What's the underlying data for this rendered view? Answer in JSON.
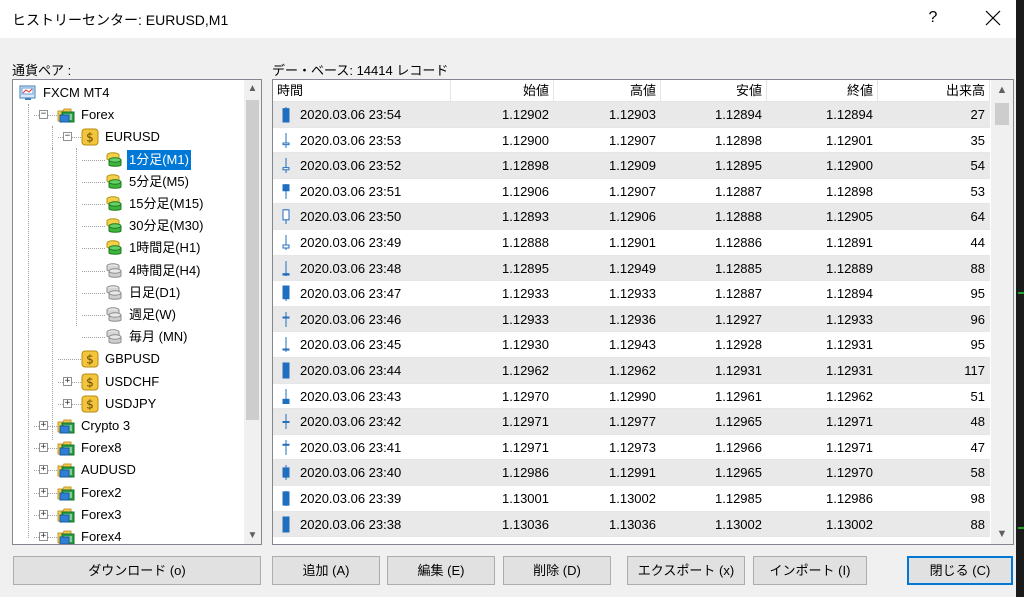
{
  "window": {
    "title": "ヒストリーセンター: EURUSD,M1",
    "help": "?"
  },
  "labels": {
    "pairs": "通貨ペア :",
    "database": "デー・ベース: 14414 レコード"
  },
  "tree": [
    {
      "label": "FXCM MT4",
      "level": 0,
      "icon": "server-icon"
    },
    {
      "label": "Forex",
      "level": 1,
      "icon": "folder-icon",
      "expander": "−"
    },
    {
      "label": "EURUSD",
      "level": 2,
      "icon": "symbol-icon",
      "expander": "−"
    },
    {
      "label": "1分足(M1)",
      "level": 3,
      "icon": "db-green-icon",
      "selected": true
    },
    {
      "label": "5分足(M5)",
      "level": 3,
      "icon": "db-green-icon"
    },
    {
      "label": "15分足(M15)",
      "level": 3,
      "icon": "db-green-icon"
    },
    {
      "label": "30分足(M30)",
      "level": 3,
      "icon": "db-green-icon"
    },
    {
      "label": "1時間足(H1)",
      "level": 3,
      "icon": "db-green-icon"
    },
    {
      "label": "4時間足(H4)",
      "level": 3,
      "icon": "db-gray-icon"
    },
    {
      "label": "日足(D1)",
      "level": 3,
      "icon": "db-gray-icon"
    },
    {
      "label": "週足(W)",
      "level": 3,
      "icon": "db-gray-icon"
    },
    {
      "label": "毎月 (MN)",
      "level": 3,
      "icon": "db-gray-icon"
    },
    {
      "label": "GBPUSD",
      "level": 2,
      "icon": "symbol-icon"
    },
    {
      "label": "USDCHF",
      "level": 2,
      "icon": "symbol-icon",
      "expander": "+"
    },
    {
      "label": "USDJPY",
      "level": 2,
      "icon": "symbol-icon",
      "expander": "+"
    },
    {
      "label": "Crypto 3",
      "level": 1,
      "icon": "folder-icon",
      "expander": "+"
    },
    {
      "label": "Forex8",
      "level": 1,
      "icon": "folder-icon",
      "expander": "+"
    },
    {
      "label": "AUDUSD",
      "level": 1,
      "icon": "folder-icon",
      "expander": "+"
    },
    {
      "label": "Forex2",
      "level": 1,
      "icon": "folder-icon",
      "expander": "+"
    },
    {
      "label": "Forex3",
      "level": 1,
      "icon": "folder-icon",
      "expander": "+"
    },
    {
      "label": "Forex4",
      "level": 1,
      "icon": "folder-icon",
      "expander": "+"
    }
  ],
  "table": {
    "columns": [
      "時間",
      "始値",
      "高値",
      "安値",
      "終値",
      "出来高"
    ],
    "rows": [
      [
        "2020.03.06 23:54",
        "1.12902",
        "1.12903",
        "1.12894",
        "1.12894",
        "27"
      ],
      [
        "2020.03.06 23:53",
        "1.12900",
        "1.12907",
        "1.12898",
        "1.12901",
        "35"
      ],
      [
        "2020.03.06 23:52",
        "1.12898",
        "1.12909",
        "1.12895",
        "1.12900",
        "54"
      ],
      [
        "2020.03.06 23:51",
        "1.12906",
        "1.12907",
        "1.12887",
        "1.12898",
        "53"
      ],
      [
        "2020.03.06 23:50",
        "1.12893",
        "1.12906",
        "1.12888",
        "1.12905",
        "64"
      ],
      [
        "2020.03.06 23:49",
        "1.12888",
        "1.12901",
        "1.12886",
        "1.12891",
        "44"
      ],
      [
        "2020.03.06 23:48",
        "1.12895",
        "1.12949",
        "1.12885",
        "1.12889",
        "88"
      ],
      [
        "2020.03.06 23:47",
        "1.12933",
        "1.12933",
        "1.12887",
        "1.12894",
        "95"
      ],
      [
        "2020.03.06 23:46",
        "1.12933",
        "1.12936",
        "1.12927",
        "1.12933",
        "96"
      ],
      [
        "2020.03.06 23:45",
        "1.12930",
        "1.12943",
        "1.12928",
        "1.12931",
        "95"
      ],
      [
        "2020.03.06 23:44",
        "1.12962",
        "1.12962",
        "1.12931",
        "1.12931",
        "117"
      ],
      [
        "2020.03.06 23:43",
        "1.12970",
        "1.12990",
        "1.12961",
        "1.12962",
        "51"
      ],
      [
        "2020.03.06 23:42",
        "1.12971",
        "1.12977",
        "1.12965",
        "1.12971",
        "48"
      ],
      [
        "2020.03.06 23:41",
        "1.12971",
        "1.12973",
        "1.12966",
        "1.12971",
        "47"
      ],
      [
        "2020.03.06 23:40",
        "1.12986",
        "1.12991",
        "1.12965",
        "1.12970",
        "58"
      ],
      [
        "2020.03.06 23:39",
        "1.13001",
        "1.13002",
        "1.12985",
        "1.12986",
        "98"
      ],
      [
        "2020.03.06 23:38",
        "1.13036",
        "1.13036",
        "1.13002",
        "1.13002",
        "88"
      ]
    ]
  },
  "buttons": {
    "download": "ダウンロード (o)",
    "add": "追加 (A)",
    "edit": "編集 (E)",
    "delete": "削除 (D)",
    "export": "エクスポート (x)",
    "import": "インポート (I)",
    "close": "閉じる (C)"
  },
  "colors": {
    "selection": "#0078d7",
    "candle_bull": "#1f6fc0",
    "row_alt": "#e9e9e9"
  }
}
